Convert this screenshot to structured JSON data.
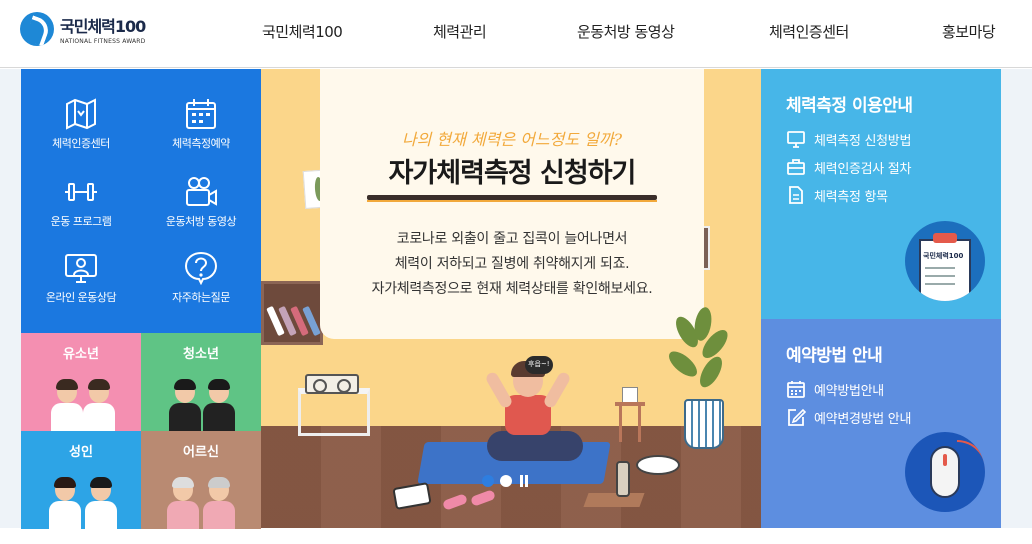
{
  "header": {
    "logo_ko": "국민체력100",
    "logo_en": "NATIONAL FITNESS AWARD",
    "nav": [
      "국민체력100",
      "체력관리",
      "운동처방 동영상",
      "체력인증센터",
      "홍보마당"
    ]
  },
  "quick_menu": {
    "items": [
      {
        "label": "체력인증센터",
        "icon": "map-icon"
      },
      {
        "label": "체력측정예약",
        "icon": "calendar-icon"
      },
      {
        "label": "운동 프로그램",
        "icon": "dumbbell-icon"
      },
      {
        "label": "운동처방 동영상",
        "icon": "video-camera-icon"
      },
      {
        "label": "온라인 운동상담",
        "icon": "monitor-person-icon"
      },
      {
        "label": "자주하는질문",
        "icon": "question-icon"
      }
    ],
    "age_groups": [
      {
        "label": "유소년",
        "color": "#f48fb1"
      },
      {
        "label": "청소년",
        "color": "#5fc485"
      },
      {
        "label": "성인",
        "color": "#2da4e6"
      },
      {
        "label": "어르신",
        "color": "#b98a72"
      }
    ]
  },
  "banner": {
    "subtitle": "나의 현재 체력은 어느정도 일까?",
    "title": "자가체력측정 신청하기",
    "desc": [
      "코로나로 외출이 줄고 집콕이 늘어나면서",
      "체력이 저하되고 질병에 취약해지게 되죠.",
      "자가체력측정으로 현재 체력상태를 확인해보세요."
    ],
    "bubble": "후읍~!",
    "slides": 2,
    "active_slide": 1,
    "colors": {
      "wall": "#fbd68a",
      "floor": "#8a5a45",
      "mat": "#3d73c8",
      "active_dot": "#2e7ee0"
    }
  },
  "panel_measure": {
    "title": "체력측정 이용안내",
    "links": [
      {
        "label": "체력측정 신청방법",
        "icon": "monitor-icon"
      },
      {
        "label": "체력인증검사 절차",
        "icon": "briefcase-icon"
      },
      {
        "label": "체력측정 항목",
        "icon": "document-icon"
      }
    ],
    "badge_text": "국민체력100",
    "color": "#47b6e8"
  },
  "panel_reserve": {
    "title": "예약방법 안내",
    "links": [
      {
        "label": "예약방법안내",
        "icon": "calendar-icon"
      },
      {
        "label": "예약변경방법 안내",
        "icon": "edit-icon"
      }
    ],
    "color": "#5d8ee0"
  }
}
